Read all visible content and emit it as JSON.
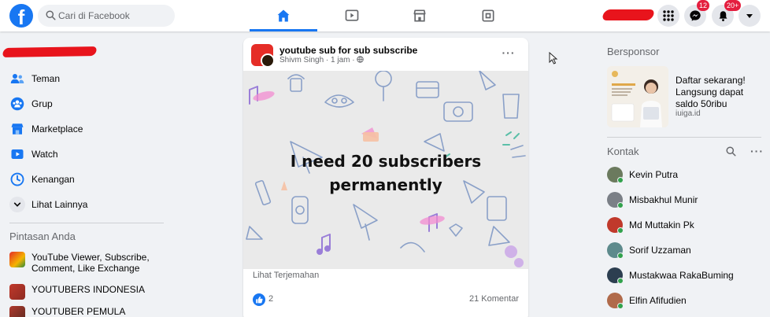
{
  "colors": {
    "brand": "#1877f2",
    "redaction": "#e8141c",
    "online": "#31a24c",
    "badge": "#e41e3f"
  },
  "topbar": {
    "logo_letter": "f",
    "search_placeholder": "Cari di Facebook",
    "tabs": [
      {
        "icon": "home-icon",
        "active": true
      },
      {
        "icon": "watch-icon",
        "active": false
      },
      {
        "icon": "marketplace-icon",
        "active": false
      },
      {
        "icon": "gaming-icon",
        "active": false
      }
    ],
    "messenger_badge": "12",
    "notifications_badge": "20+"
  },
  "left_nav": {
    "items": [
      {
        "label": "Teman",
        "icon": "friends-icon"
      },
      {
        "label": "Grup",
        "icon": "groups-icon"
      },
      {
        "label": "Marketplace",
        "icon": "marketplace-icon"
      },
      {
        "label": "Watch",
        "icon": "watch-icon"
      },
      {
        "label": "Kenangan",
        "icon": "memories-icon"
      },
      {
        "label": "Lihat Lainnya",
        "icon": "chevron-down-icon"
      }
    ],
    "shortcuts_title": "Pintasan Anda",
    "shortcuts": [
      {
        "label": "YouTube Viewer, Subscribe, Comment, Like Exchange"
      },
      {
        "label": "YOUTUBERS INDONESIA"
      },
      {
        "label": "YOUTUBER PEMULA INDONESIA |"
      }
    ]
  },
  "post": {
    "group_name": "youtube sub for sub subscribe",
    "meta": "Shivm Singh · 1 jam · ",
    "image_text_line1": "I need 20 subscribers",
    "image_text_line2": "permanently",
    "translate_label": "Lihat Terjemahan",
    "like_count": "2",
    "comment_count": "21 Komentar"
  },
  "right": {
    "sponsored_title": "Bersponsor",
    "ad": {
      "text": "Daftar sekarang! Langsung dapat saldo 50ribu",
      "domain": "iuiga.id"
    },
    "contacts_title": "Kontak",
    "contacts": [
      {
        "name": "Kevin Putra",
        "color": "#6b7a5e"
      },
      {
        "name": "Misbakhul Munir",
        "color": "#7a7f86"
      },
      {
        "name": "Md Muttakin Pk",
        "color": "#c0392b"
      },
      {
        "name": "Sorif Uzzaman",
        "color": "#5d8a8c"
      },
      {
        "name": "Mustakwaa RakaBuming",
        "color": "#2c3e50"
      },
      {
        "name": "Elfin Afifudien",
        "color": "#b06a4a"
      }
    ]
  }
}
